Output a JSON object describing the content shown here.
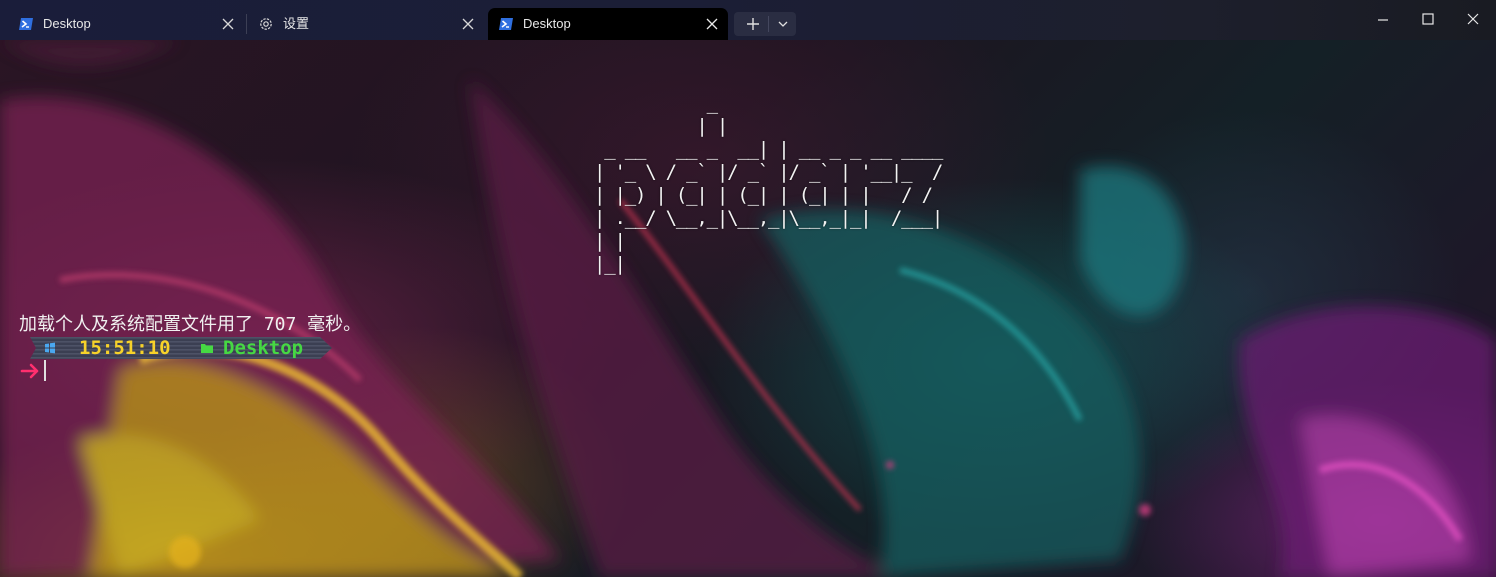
{
  "tabs": [
    {
      "label": "Desktop",
      "icon": "powershell-icon",
      "active": false
    },
    {
      "label": "设置",
      "icon": "gear-icon",
      "active": false
    },
    {
      "label": "Desktop",
      "icon": "powershell-icon",
      "active": true
    }
  ],
  "window_controls": [
    "minimize",
    "maximize",
    "close"
  ],
  "terminal": {
    "ascii_banner": "           _\n          | |\n _ __   __ _  __| | __ _ _ __ ____\n| '_ \\ / _` |/ _` |/ _` | '__|_  /\n| |_) | (_| | (_| | (_| | |   / /\n| .__/ \\__,_|\\__,_|\\__,_|_|  /___|\n| |\n|_|",
    "load_message": "加载个人及系统配置文件用了 707 毫秒。",
    "prompt": {
      "time": "15:51:10",
      "directory": "Desktop",
      "os_icon": "windows-icon",
      "folder_icon": "folder-icon"
    },
    "input_arrow": "arrow-right-icon"
  },
  "colors": {
    "titlebar": "#1b1e36",
    "active_tab": "#000000",
    "time": "#f7d22a",
    "directory": "#46d843",
    "arrow": "#ff2f6e",
    "powershell_icon": "#2f6fe0"
  }
}
